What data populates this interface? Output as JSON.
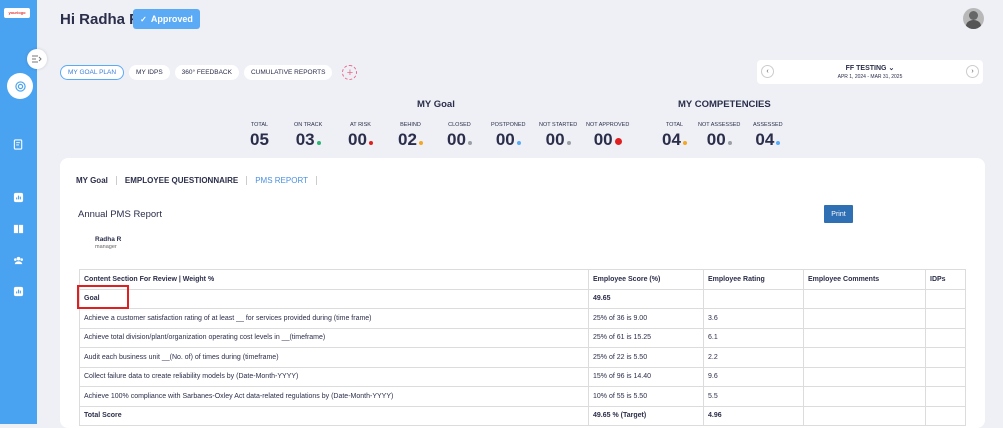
{
  "app": {
    "logo_text": "yourlogo"
  },
  "header": {
    "greeting": "Hi Radha R",
    "status_badge": "Approved"
  },
  "tabs": [
    "MY GOAL PLAN",
    "MY IDPS",
    "360° FEEDBACK",
    "CUMULATIVE REPORTS"
  ],
  "period": {
    "name": "FF TESTING",
    "range": "APR 1, 2024 - MAR 31, 2025"
  },
  "my_goal": {
    "title": "MY Goal",
    "stats": [
      {
        "label": "TOTAL",
        "value": "05",
        "dot": ""
      },
      {
        "label": "ON TRACK",
        "value": "03",
        "dot": "#2bb673"
      },
      {
        "label": "AT RISK",
        "value": "00",
        "dot": "#e02020"
      },
      {
        "label": "BEHIND",
        "value": "02",
        "dot": "#f5a623"
      },
      {
        "label": "CLOSED",
        "value": "00",
        "dot": "#9aa0a6"
      },
      {
        "label": "POSTPONED",
        "value": "00",
        "dot": "#5aaaf5"
      },
      {
        "label": "NOT STARTED",
        "value": "00",
        "dot": "#9aa0a6"
      },
      {
        "label": "NOT APPROVED",
        "value": "00",
        "dot": "#e02020"
      }
    ]
  },
  "my_competencies": {
    "title": "MY COMPETENCIES",
    "stats": [
      {
        "label": "TOTAL",
        "value": "04",
        "dot": "#f5a623"
      },
      {
        "label": "NOT ASSESSED",
        "value": "00",
        "dot": "#9aa0a6"
      },
      {
        "label": "ASSESSED",
        "value": "04",
        "dot": "#5aaaf5"
      }
    ]
  },
  "subtabs": [
    "MY Goal",
    "EMPLOYEE QUESTIONNAIRE",
    "PMS REPORT"
  ],
  "report": {
    "title": "Annual PMS Report",
    "print_label": "Print",
    "employee_name": "Radha R",
    "employee_role": "manager",
    "columns": [
      "Content Section For Review | Weight %",
      "Employee Score (%)",
      "Employee Rating",
      "Employee Comments",
      "IDPs"
    ],
    "rows": [
      {
        "content": "Goal",
        "score": "49.65",
        "rating": "",
        "comments": "",
        "idps": "",
        "bold": true
      },
      {
        "content": "Achieve a customer satisfaction rating of at least __ for services provided during (time frame)",
        "score": "25% of 36 is 9.00",
        "rating": "3.6",
        "comments": "",
        "idps": ""
      },
      {
        "content": "Achieve total division/plant/organization operating cost levels in __(timeframe)",
        "score": "25% of 61 is 15.25",
        "rating": "6.1",
        "comments": "",
        "idps": ""
      },
      {
        "content": "Audit each business unit __(No. of) of times during (timeframe)",
        "score": "25% of 22 is 5.50",
        "rating": "2.2",
        "comments": "",
        "idps": ""
      },
      {
        "content": "Collect failure data to create reliability models by (Date-Month-YYYY)",
        "score": "15% of 96 is 14.40",
        "rating": "9.6",
        "comments": "",
        "idps": ""
      },
      {
        "content": "Achieve 100% compliance with Sarbanes-Oxley Act data-related regulations by (Date-Month-YYYY)",
        "score": "10% of 55 is 5.50",
        "rating": "5.5",
        "comments": "",
        "idps": ""
      },
      {
        "content": "Total Score",
        "score": "49.65 % (Target)",
        "rating": "4.96",
        "comments": "",
        "idps": "",
        "bold": true
      }
    ]
  }
}
